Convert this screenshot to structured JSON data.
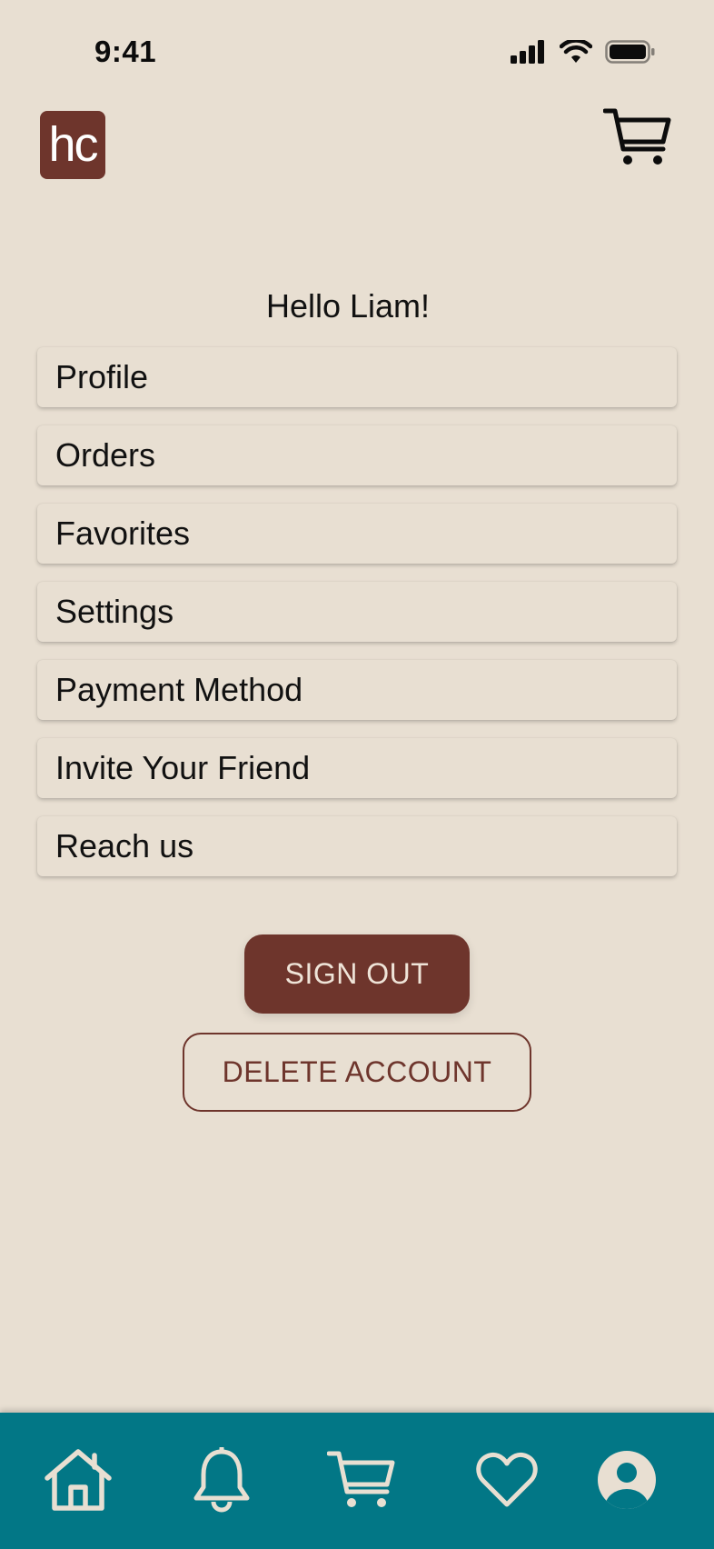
{
  "status_bar": {
    "time": "9:41"
  },
  "header": {
    "logo_text": "hc"
  },
  "greeting": "Hello Liam!",
  "menu": [
    {
      "label": "Profile"
    },
    {
      "label": "Orders"
    },
    {
      "label": "Favorites"
    },
    {
      "label": "Settings"
    },
    {
      "label": "Payment Method"
    },
    {
      "label": "Invite Your Friend"
    },
    {
      "label": "Reach us"
    }
  ],
  "actions": {
    "sign_out": "SIGN OUT",
    "delete_account": "DELETE ACCOUNT"
  },
  "tabbar": {
    "items": [
      {
        "icon": "home-icon"
      },
      {
        "icon": "bell-icon"
      },
      {
        "icon": "cart-icon"
      },
      {
        "icon": "heart-icon"
      },
      {
        "icon": "user-icon",
        "active": true
      }
    ]
  },
  "colors": {
    "background": "#e8dfd2",
    "brand": "#6e352c",
    "tabbar": "#027786",
    "tab_icon": "#e8dfd2"
  }
}
